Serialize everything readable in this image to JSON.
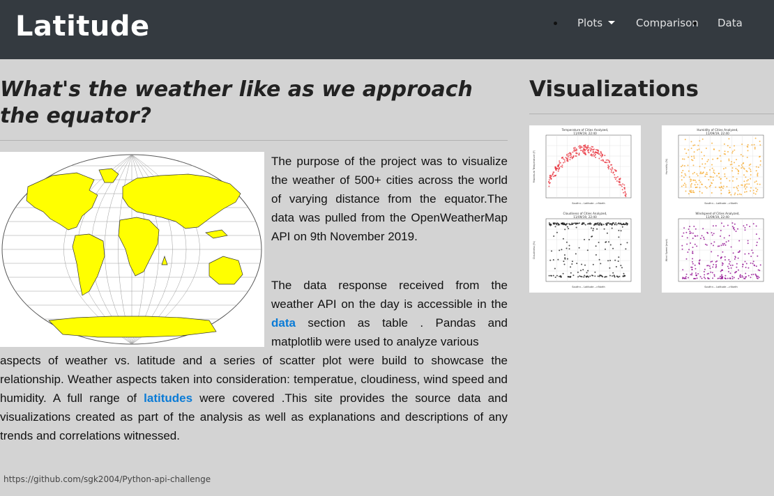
{
  "navbar": {
    "brand": "Latitude",
    "links": [
      "Plots",
      "Comparison",
      "Data"
    ]
  },
  "article": {
    "heading": "What's the weather like as we approach the equator?",
    "p1": "The purpose of the project was to visualize the weather of 500+ cities across the world of varying distance from the equator.The data was pulled from the OpenWeatherMap API on 9th November 2019.",
    "p2_a": "The data response received from the weather API on the day is accessible in the",
    "p2_link_data": "data",
    "p2_b": "section as table . Pandas and matplotlib were used to analyze various",
    "p2_c": "aspects of weather vs. latitude and a series of scatter plot were build to showcase the relationship. Weather aspects taken into consideration: temperatue, cloudiness, wind speed and humidity. A full range of",
    "p2_link_lat": "latitudes",
    "p2_d": "were covered .This site provides the source data and visualizations created as part of the analysis as well as explanations and descriptions of any trends and correlations witnessed."
  },
  "sidebar": {
    "title": "Visualizations",
    "plots": [
      {
        "title": "Temperature of Cities Analyzed,",
        "date": "11/09/19, 22:40",
        "ylabel": "Maximum Temperature (F)",
        "color": "#e8323c"
      },
      {
        "title": "Humidity of Cities Analyzed,",
        "date": "11/09/19, 22:40",
        "ylabel": "Humidity (%)",
        "color": "#f5a623"
      },
      {
        "title": "Cloudiness of Cities Analyzed,",
        "date": "11/09/19, 22:40",
        "ylabel": "Cloudiness (%)",
        "color": "#111111"
      },
      {
        "title": "Windspeed of Cities Analyzed,",
        "date": "11/09/19, 22:40",
        "ylabel": "Wind Speed (mph)",
        "color": "#8b008b"
      }
    ],
    "xlabel": "South<-- Latitude -->North"
  },
  "status_url": "https://github.com/sgk2004/Python-api-challenge"
}
